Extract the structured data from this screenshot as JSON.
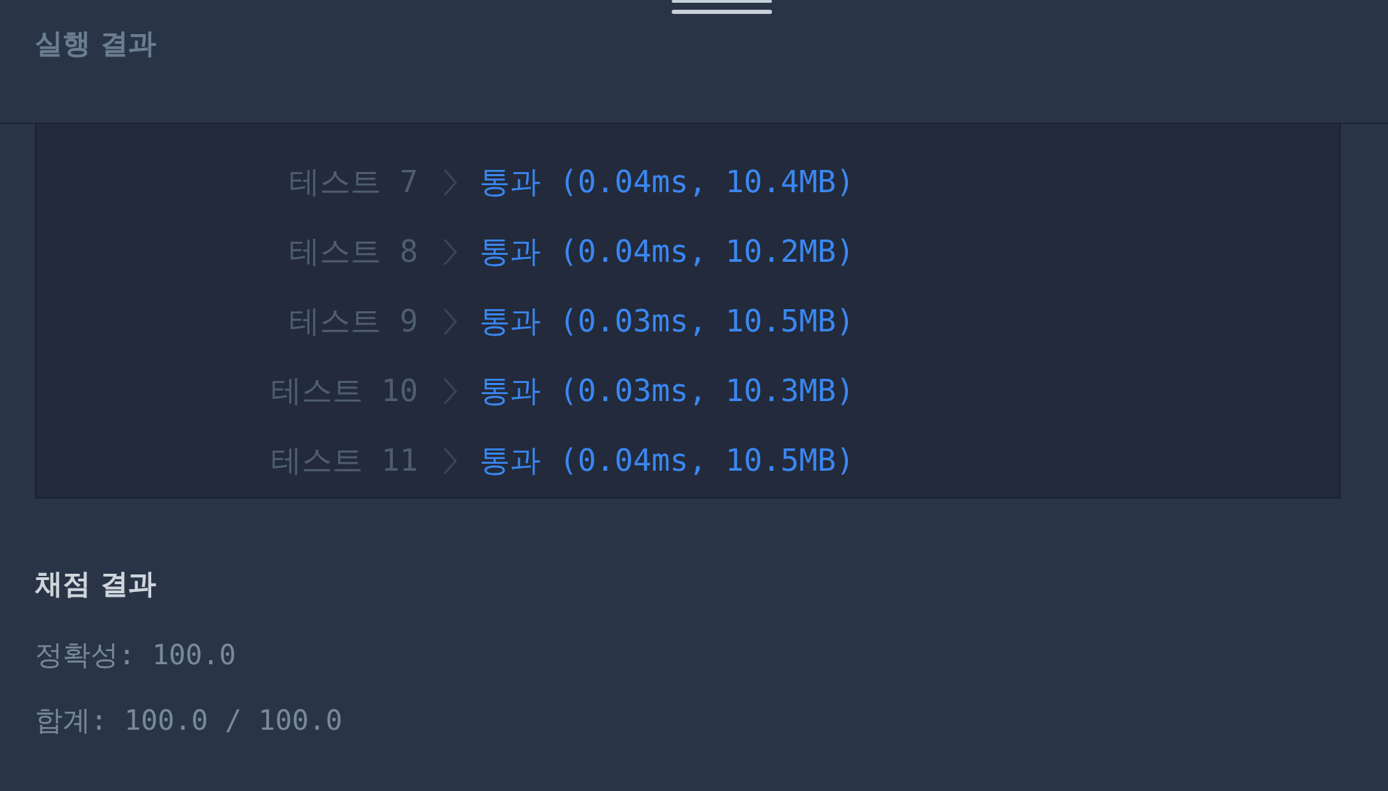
{
  "header": {
    "title": "실행 결과"
  },
  "results": [
    {
      "label": "테스트 7",
      "kind": "pass",
      "text": "통과 (0.04ms, 10.4MB)"
    },
    {
      "label": "테스트 8",
      "kind": "pass",
      "text": "통과 (0.04ms, 10.2MB)"
    },
    {
      "label": "테스트 9",
      "kind": "pass",
      "text": "통과 (0.03ms, 10.5MB)"
    },
    {
      "label": "테스트 10",
      "kind": "pass",
      "text": "통과 (0.03ms, 10.3MB)"
    },
    {
      "label": "테스트 11",
      "kind": "pass",
      "text": "통과 (0.04ms, 10.5MB)"
    }
  ],
  "grading": {
    "title": "채점 결과",
    "lines": [
      "정확성: 100.0",
      "합계: 100.0 / 100.0"
    ]
  }
}
